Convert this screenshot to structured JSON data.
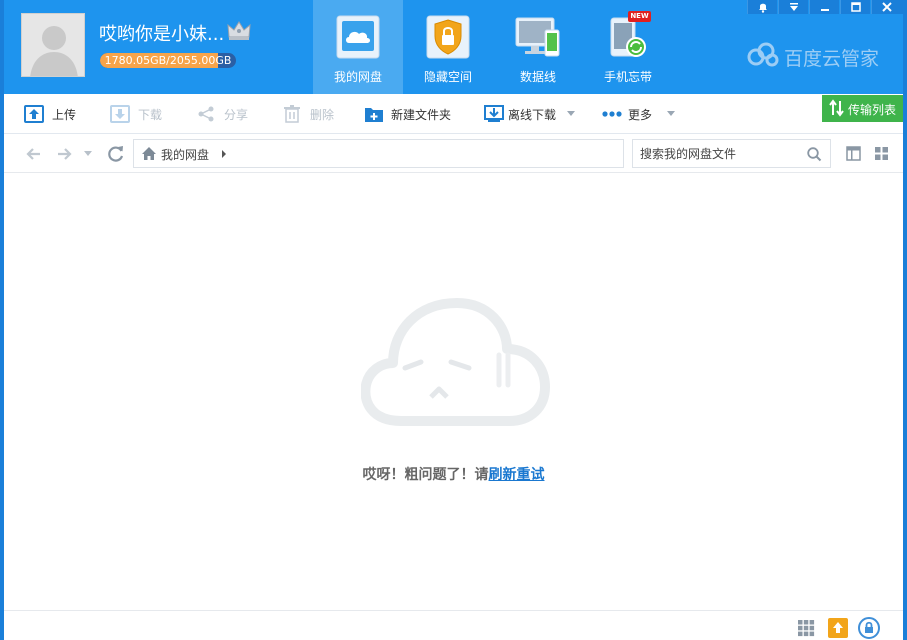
{
  "user": {
    "name": "哎哟你是小妹...",
    "quota_text": "1780.05GB/2055.00GB",
    "quota_fraction": 0.866
  },
  "nav_tabs": [
    {
      "label": "我的网盘",
      "icon": "cloud-drive-icon",
      "active": true
    },
    {
      "label": "隐藏空间",
      "icon": "lock-icon",
      "active": false
    },
    {
      "label": "数据线",
      "icon": "monitor-phone-icon",
      "active": false
    },
    {
      "label": "手机忘带",
      "icon": "phone-sync-icon",
      "active": false,
      "badge": "NEW"
    }
  ],
  "brand": {
    "name": "百度云管家"
  },
  "toolbar": {
    "upload": "上传",
    "download": "下载",
    "share": "分享",
    "delete": "删除",
    "new_folder": "新建文件夹",
    "offline_download": "离线下载",
    "more": "更多",
    "transfer_list": "传输列表"
  },
  "address": {
    "breadcrumb": "我的网盘",
    "search_placeholder": "搜索我的网盘文件"
  },
  "content": {
    "error_message": "哎呀！粗问题了！请",
    "retry_link": "刷新重试"
  },
  "colors": {
    "header_blue": "#1e94ee",
    "active_tab": "#4aaaf1",
    "transfer_green": "#3fb44b",
    "link_blue": "#1a78d0",
    "quota_orange": "#f7a44a"
  }
}
